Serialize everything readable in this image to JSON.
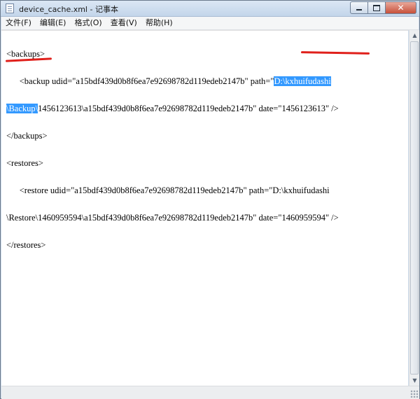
{
  "window": {
    "title": "device_cache.xml - 记事本",
    "controls": {
      "minimize": "",
      "maximize": "",
      "close": "✕"
    }
  },
  "menu": {
    "items": [
      "文件(F)",
      "编辑(E)",
      "格式(O)",
      "查看(V)",
      "帮助(H)"
    ]
  },
  "document": {
    "line1": "<backups>",
    "line2_pre": "      <backup udid=\"a15bdf439d0b8f6ea7e92698782d119edeb2147b\" path=\"",
    "line2_sel": "D:\\kxhuifudashi",
    "line3_sel": "\\Backup\\",
    "line3_post": "1456123613\\a15bdf439d0b8f6ea7e92698782d119edeb2147b\" date=\"1456123613\" />",
    "line4": "</backups>",
    "line5": "<restores>",
    "line6": "      <restore udid=\"a15bdf439d0b8f6ea7e92698782d119edeb2147b\" path=\"D:\\kxhuifudashi",
    "line7": "\\Restore\\1460959594\\a15bdf439d0b8f6ea7e92698782d119edeb2147b\" date=\"1460959594\" />",
    "line8": "</restores>"
  },
  "colors": {
    "selection": "#3399ff",
    "annotation": "#e0201b"
  }
}
